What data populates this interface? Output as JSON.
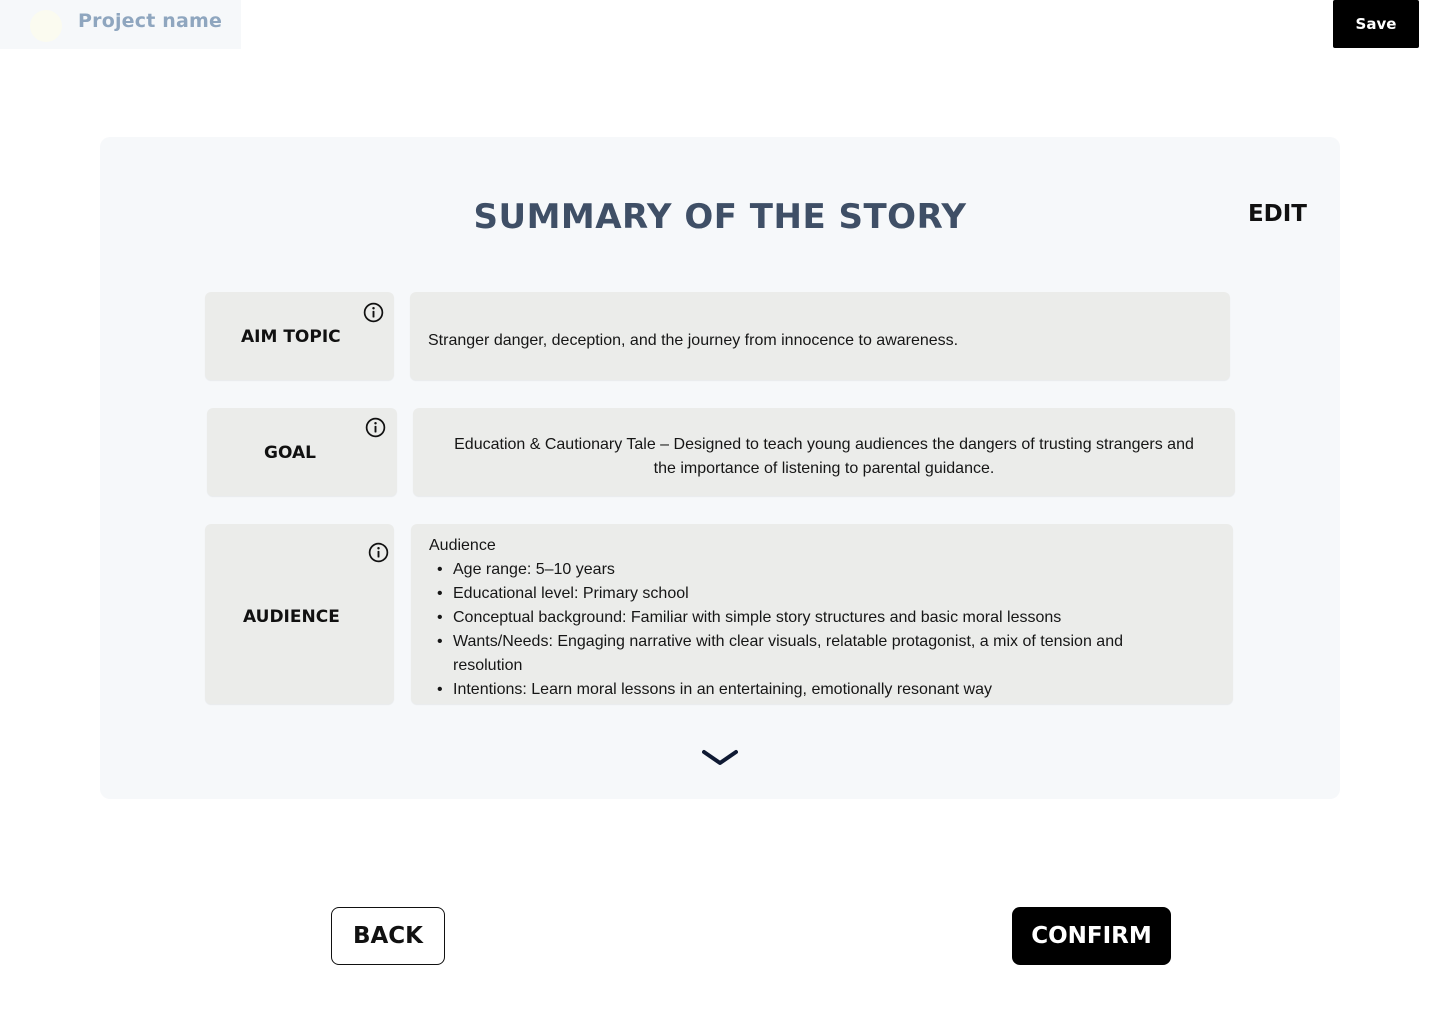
{
  "header": {
    "project_name": "Project name",
    "save_label": "Save"
  },
  "summary": {
    "title": "SUMMARY OF THE STORY",
    "edit_label": "EDIT",
    "aim_topic": {
      "label": "AIM TOPIC",
      "value": "Stranger danger, deception, and the journey from innocence to awareness."
    },
    "goal": {
      "label": "GOAL",
      "value": "Education & Cautionary Tale – Designed to teach young audiences the dangers of trusting strangers and the importance of listening to parental guidance."
    },
    "audience": {
      "label": "AUDIENCE",
      "heading": "Audience",
      "items": [
        "Age range: 5–10 years",
        "Educational level: Primary school",
        "Conceptual background: Familiar with simple story structures and basic moral lessons",
        "Wants/Needs: Engaging narrative with clear visuals, relatable protagonist, a mix of tension and resolution",
        "Intentions: Learn moral lessons in an entertaining, emotionally resonant way"
      ]
    }
  },
  "footer": {
    "back_label": "BACK",
    "confirm_label": "CONFIRM"
  },
  "icons": {
    "info": "info-icon",
    "expand": "chevron-down-icon"
  },
  "colors": {
    "title": "#3f4f66",
    "project_name": "#8fa6bf",
    "card_bg": "#f6f8fa",
    "box_bg": "#ebecea",
    "primary_button": "#000000"
  }
}
